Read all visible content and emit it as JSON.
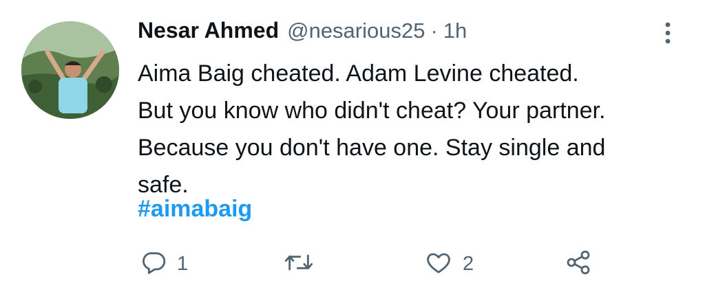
{
  "tweet": {
    "author_name": "Nesar Ahmed",
    "handle": "@nesarious25",
    "separator": "·",
    "time": "1h",
    "lines": [
      "Aima Baig cheated. Adam Levine cheated.",
      "But you know who didn't cheat? Your partner.",
      "Because you don't have one. Stay single and",
      "safe."
    ],
    "hashtag": "#aimabaig"
  },
  "actions": {
    "reply_count": "1",
    "like_count": "2",
    "icons": [
      "reply-icon",
      "retweet-icon",
      "like-icon",
      "share-icon"
    ]
  },
  "colors": {
    "text": "#0f1419",
    "muted": "#536471",
    "hashtag": "#1d9bf0"
  }
}
